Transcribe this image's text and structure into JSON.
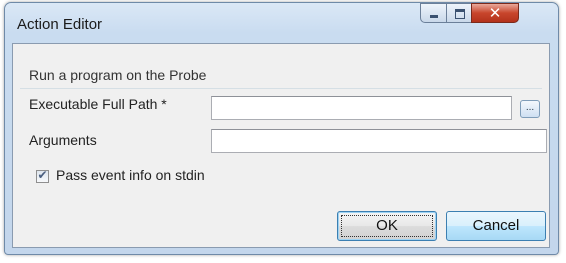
{
  "window": {
    "title": "Action Editor",
    "controls": {
      "minimize": "minimize-icon",
      "maximize": "maximize-icon",
      "close": "close-icon"
    }
  },
  "group": {
    "title": "Run a program on the Probe"
  },
  "form": {
    "executable_label": "Executable Full Path *",
    "executable_value": "",
    "browse_label": "...",
    "arguments_label": "Arguments",
    "arguments_value": "",
    "pass_event_label": "Pass event info on stdin",
    "pass_event_checked": true
  },
  "buttons": {
    "ok_label": "OK",
    "cancel_label": "Cancel"
  },
  "colors": {
    "frame": "#c3d6ec",
    "client": "#f0f0f0",
    "close_button": "#c8452c",
    "cancel_hover": "#bee6fd"
  }
}
